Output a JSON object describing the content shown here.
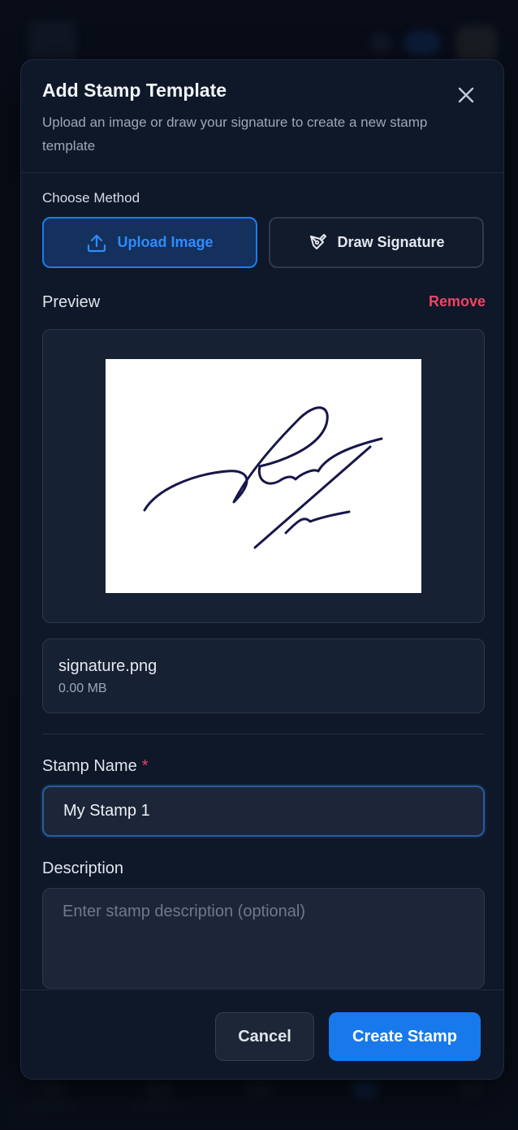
{
  "modal": {
    "title": "Add Stamp Template",
    "subtitle": "Upload an image or draw your signature to create a new stamp template"
  },
  "method": {
    "label": "Choose Method",
    "upload_label": "Upload Image",
    "draw_label": "Draw Signature",
    "selected": "Upload Image"
  },
  "preview": {
    "label": "Preview",
    "remove_label": "Remove"
  },
  "file": {
    "name": "signature.png",
    "size": "0.00 MB"
  },
  "stamp_name": {
    "label": "Stamp Name",
    "required_mark": "*",
    "value": "My Stamp 1"
  },
  "description": {
    "label": "Description",
    "placeholder": "Enter stamp description (optional)",
    "value": ""
  },
  "footer": {
    "cancel_label": "Cancel",
    "create_label": "Create Stamp"
  },
  "colors": {
    "accent": "#1879ec",
    "danger": "#ef4464",
    "ink": "#16164a"
  }
}
